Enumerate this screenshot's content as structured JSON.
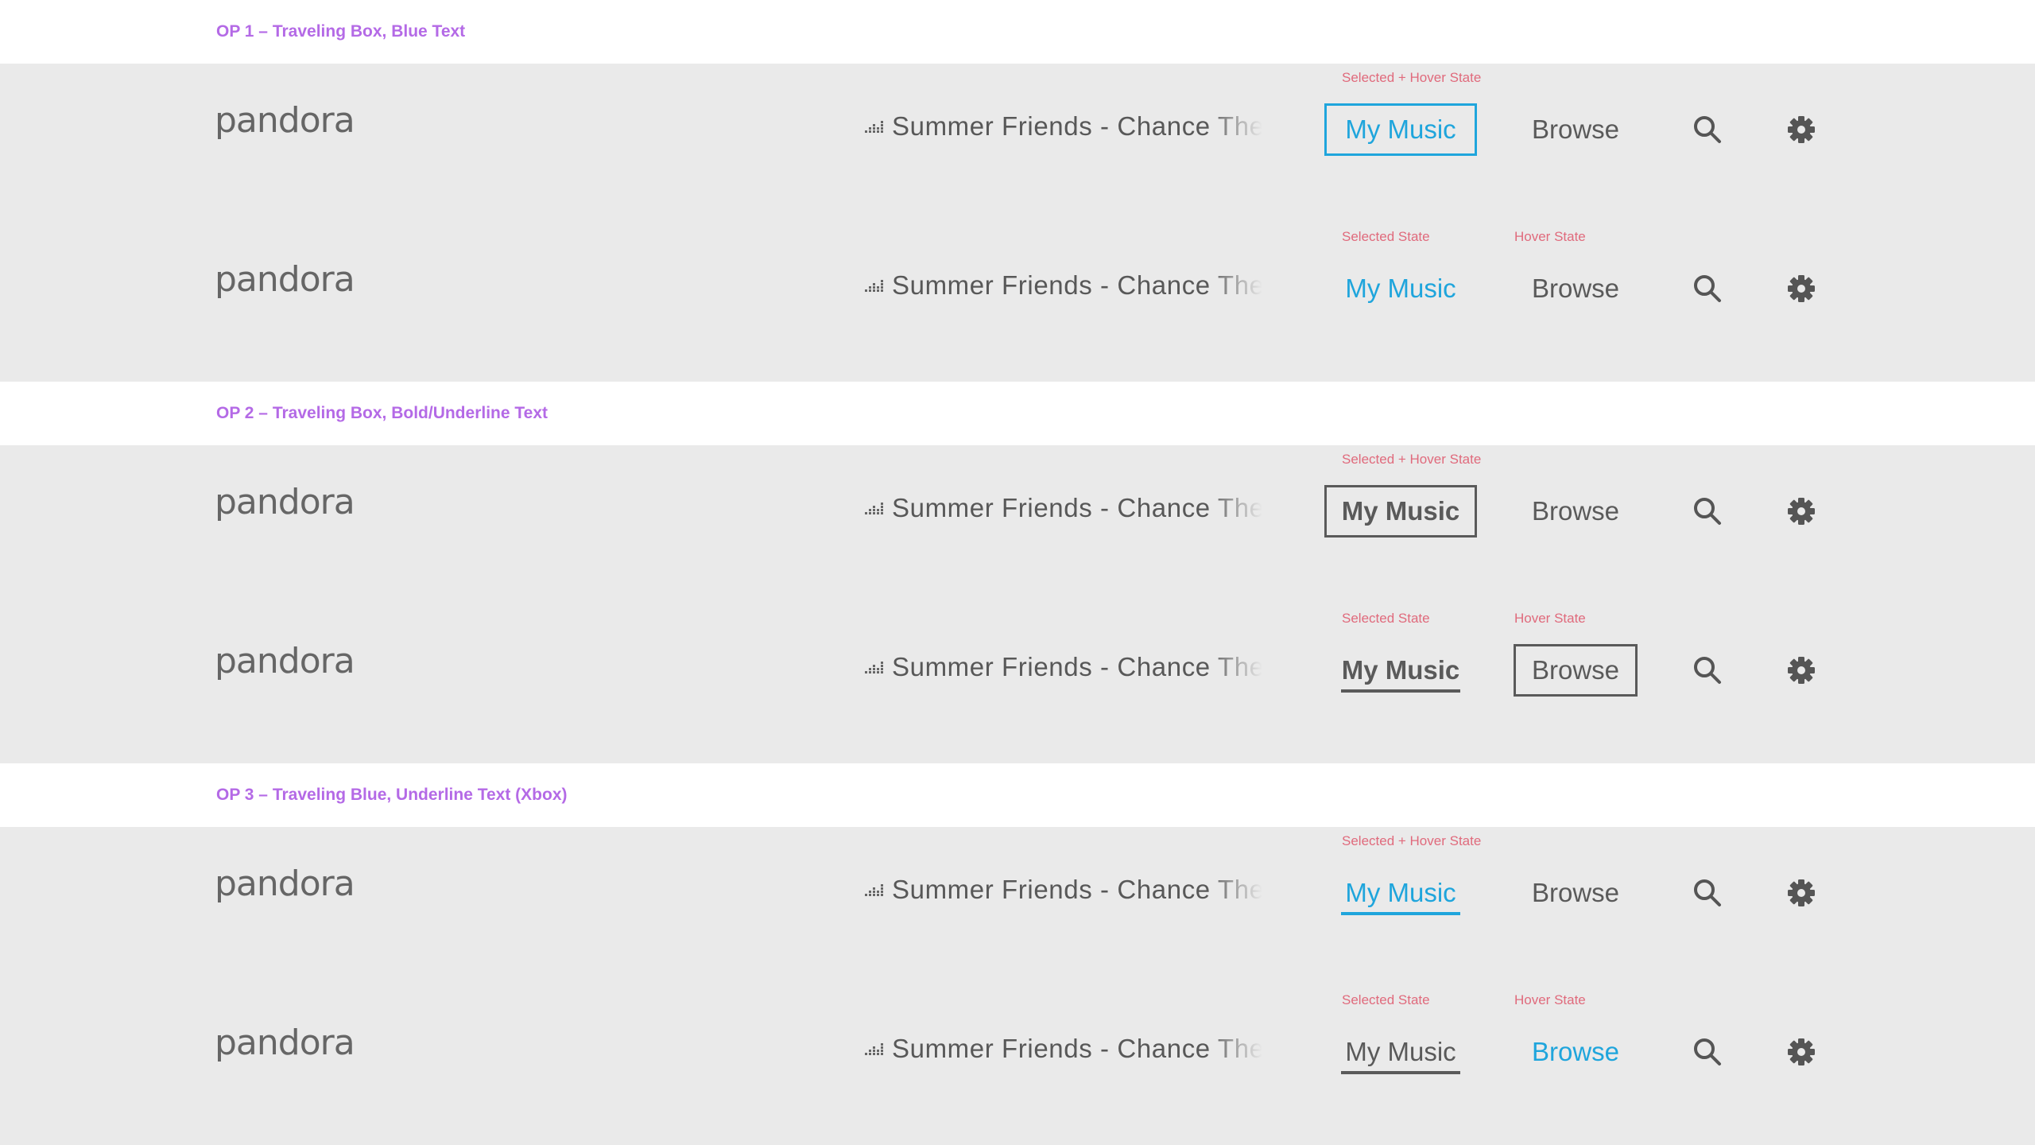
{
  "sections": [
    {
      "label": "OP 1 – Traveling Box, Blue Text",
      "rows": [
        {
          "state_a": "Selected + Hover State",
          "state_b": ""
        },
        {
          "state_a": "Selected State",
          "state_b": "Hover State"
        }
      ]
    },
    {
      "label": "OP 2 – Traveling Box, Bold/Underline Text",
      "rows": [
        {
          "state_a": "Selected + Hover State",
          "state_b": ""
        },
        {
          "state_a": "Selected State",
          "state_b": "Hover State"
        }
      ]
    },
    {
      "label": "OP 3 – Traveling Blue, Underline Text (Xbox)",
      "rows": [
        {
          "state_a": "Selected + Hover State",
          "state_b": ""
        },
        {
          "state_a": "Selected State",
          "state_b": "Hover State"
        }
      ]
    }
  ],
  "header": {
    "logo": "pandora",
    "now_playing": "Summer Friends - Chance The Rapper",
    "nav_mymusic": "My Music",
    "nav_browse": "Browse"
  },
  "icons": {
    "now_playing": "equalizer-icon",
    "search": "search-icon",
    "settings": "gear-icon"
  },
  "colors": {
    "accent_blue": "#1fa5dc",
    "annotation_pink": "#e06a7c",
    "section_purple": "#b46ae6",
    "band_gray": "#eaeaea",
    "text_gray": "#5a5a5a"
  }
}
